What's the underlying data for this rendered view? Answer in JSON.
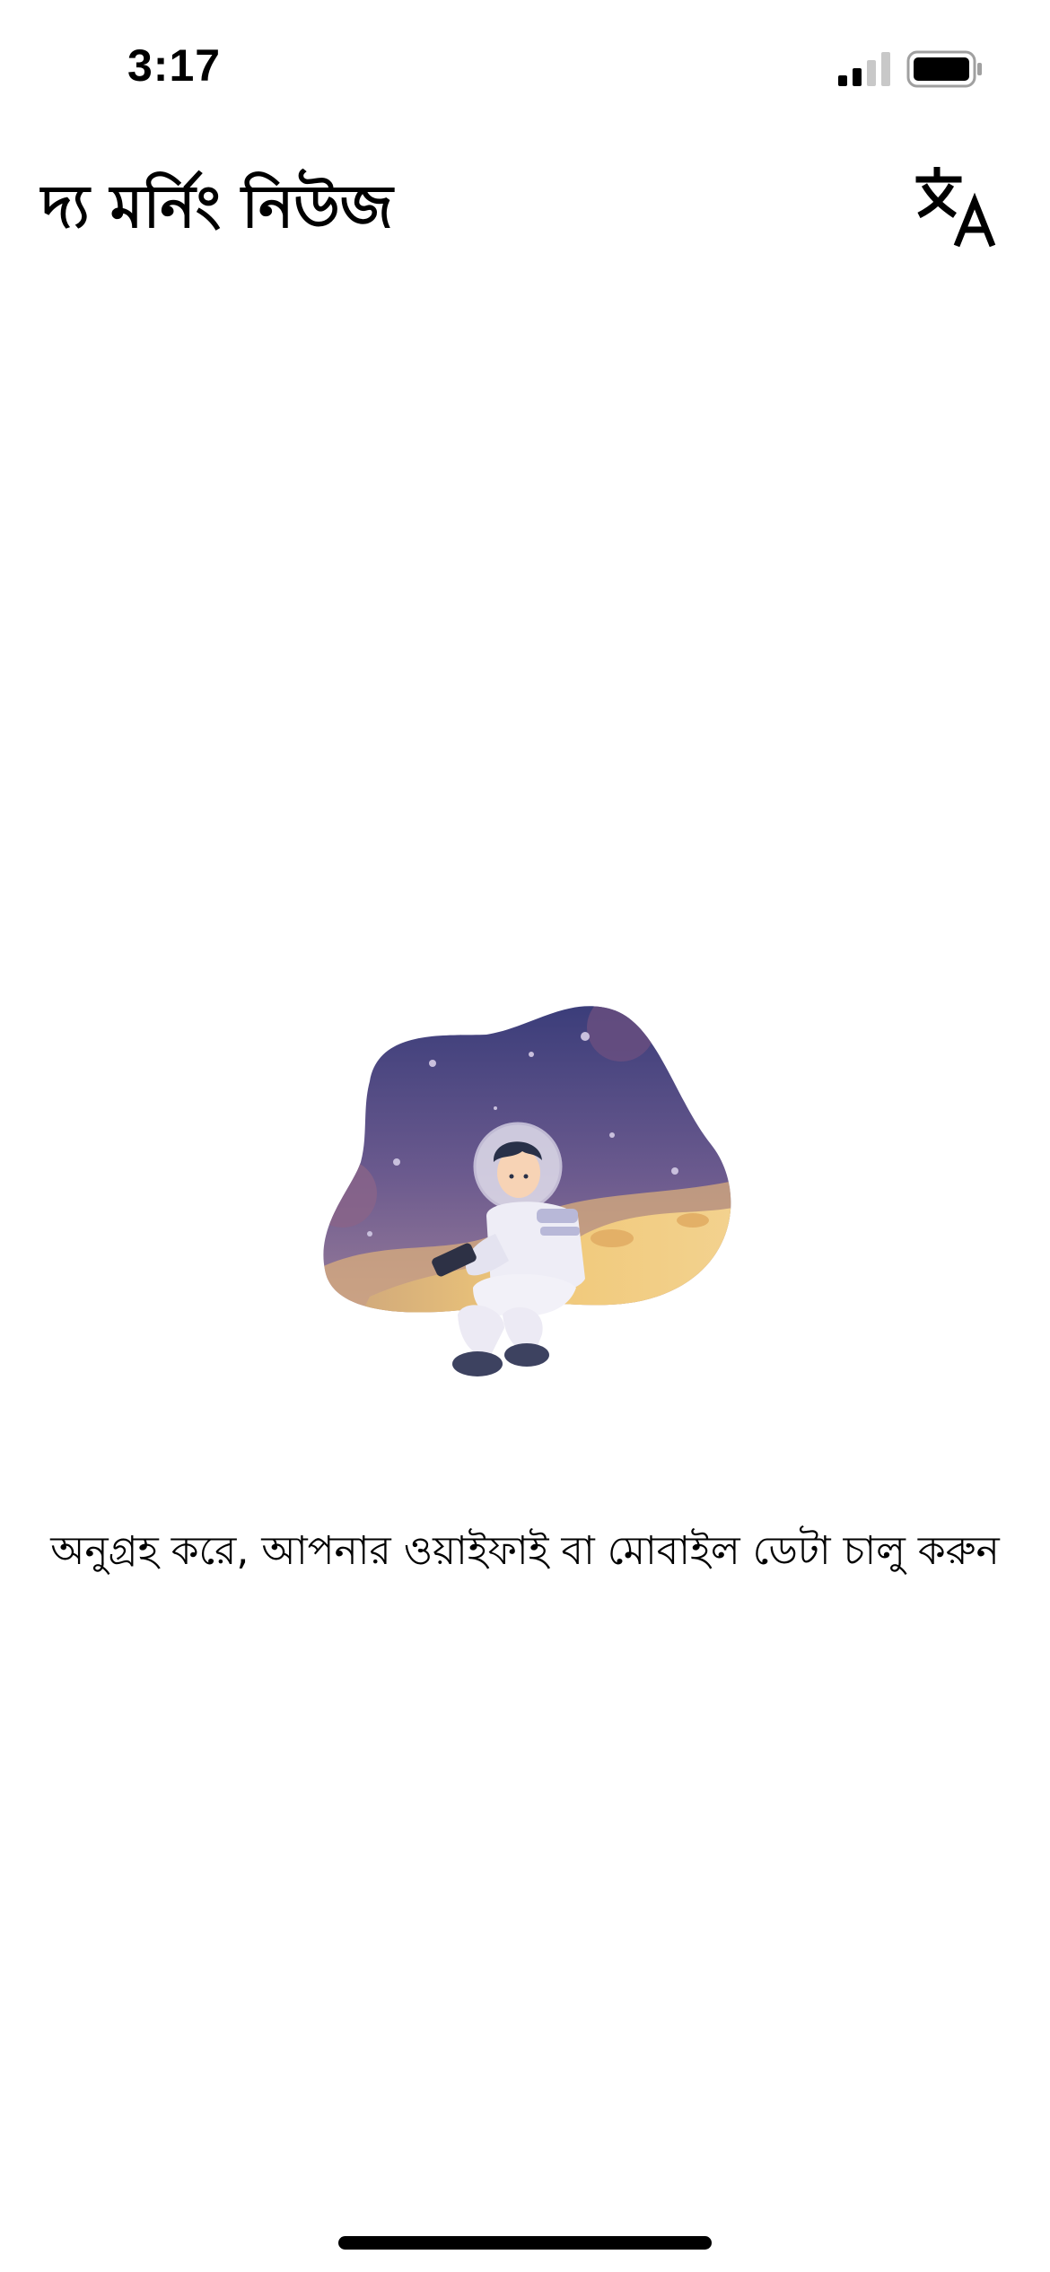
{
  "status_bar": {
    "time": "3:17",
    "signal_icon": "cellular-signal-icon",
    "battery_icon": "battery-icon"
  },
  "header": {
    "title": "দ্য মর্নিং নিউজ",
    "translate_icon": "translate-icon"
  },
  "main": {
    "illustration": "astronaut-offline-illustration",
    "message": "অনুগ্রহ করে, আপনার ওয়াইফাই বা মোবাইল ডেটা চালু করুন"
  },
  "colors": {
    "background": "#ffffff",
    "text": "#000000",
    "space_dark": "#3b3d7a",
    "space_mid": "#8a7097",
    "moon_sand": "#f0c878"
  }
}
